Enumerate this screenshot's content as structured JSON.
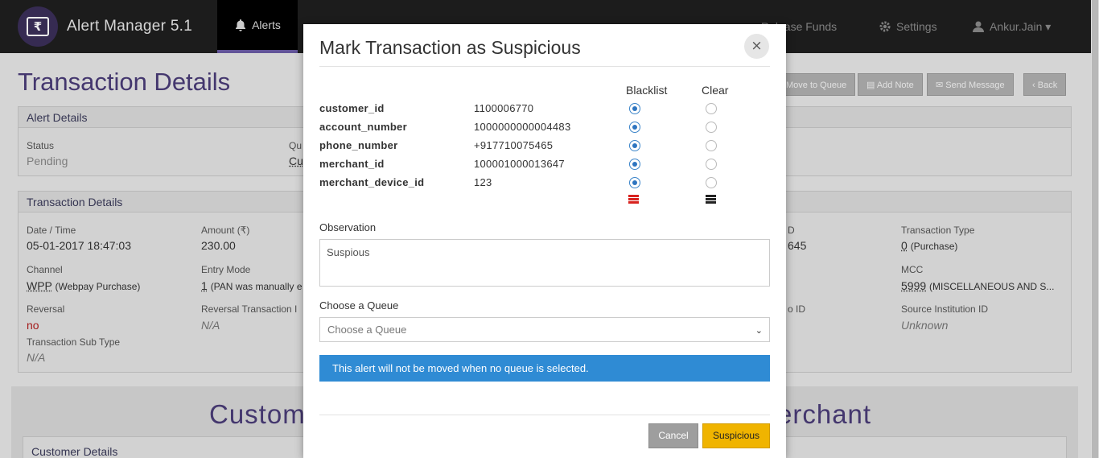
{
  "app": {
    "title": "Alert Manager 5.1",
    "logo_symbol": "₹"
  },
  "nav": {
    "active": "Alerts",
    "items": [
      {
        "label": "Alerts",
        "icon": "bell-icon"
      },
      {
        "label": "Release Funds",
        "icon": "money-icon"
      },
      {
        "label": "Settings",
        "icon": "gear-icon"
      },
      {
        "label": "Ankur.Jain",
        "icon": "user-icon"
      }
    ],
    "user_caret": "▾"
  },
  "page": {
    "title": "Transaction Details",
    "buttons": [
      "Move to Queue",
      "Add Note",
      "Send Message",
      "Back"
    ]
  },
  "alert_details": {
    "heading": "Alert Details",
    "status_label": "Status",
    "status_value": "Pending",
    "queue_label_partial": "Qu",
    "queue_value_partial": "Cu"
  },
  "transaction_details": {
    "heading": "Transaction Details",
    "date_label": "Date / Time",
    "date_value": "05-01-2017 18:47:03",
    "amount_label": "Amount (₹)",
    "amount_value": "230.00",
    "channel_label": "Channel",
    "channel_code": "WPP",
    "channel_desc": "(Webpay Purchase)",
    "entry_label": "Entry Mode",
    "entry_code": "1",
    "entry_desc": "(PAN was manually e",
    "reversal_label": "Reversal",
    "reversal_value": "no",
    "rev_txn_label": "Reversal Transaction I",
    "rev_txn_value": "N/A",
    "sub_type_label": "Transaction Sub Type",
    "sub_type_value": "N/A",
    "partial_id_label": "D",
    "partial_id_value": "645",
    "partial_label2": "o ID",
    "type_label": "Transaction Type",
    "type_code": "0",
    "type_desc": "(Purchase)",
    "mcc_label": "MCC",
    "mcc_code": "5999",
    "mcc_desc": "(MISCELLANEOUS AND S...",
    "source_label": "Source Institution ID",
    "source_value": "Unknown"
  },
  "lower": {
    "customer_heading": "Custom",
    "merchant_heading": "erchant",
    "customer_details": "Customer Details"
  },
  "modal": {
    "title": "Mark Transaction as Suspicious",
    "close_symbol": "×",
    "col_blacklist": "Blacklist",
    "col_clear": "Clear",
    "fields": [
      {
        "key": "customer_id",
        "value": "1100006770",
        "selection": "blacklist"
      },
      {
        "key": "account_number",
        "value": "1000000000004483",
        "selection": "blacklist"
      },
      {
        "key": "phone_number",
        "value": "+917710075465",
        "selection": "blacklist"
      },
      {
        "key": "merchant_id",
        "value": "100001000013647",
        "selection": "blacklist"
      },
      {
        "key": "merchant_device_id",
        "value": "123",
        "selection": "blacklist"
      }
    ],
    "observation_label": "Observation",
    "observation_value": "Suspious",
    "queue_label": "Choose a Queue",
    "queue_placeholder": "Choose a Queue",
    "info_text": "This alert will not be moved when no queue is selected.",
    "cancel_label": "Cancel",
    "submit_label": "Suspicious"
  },
  "colors": {
    "nav_bg": "#1f1f1f",
    "brand_purple": "#4a3c78",
    "radio_blue": "#2e75c0",
    "info_blue": "#2f8bd4",
    "submit_yellow": "#f0b400",
    "blacklist_icon": "#d8221e",
    "clear_icon": "#222222"
  }
}
